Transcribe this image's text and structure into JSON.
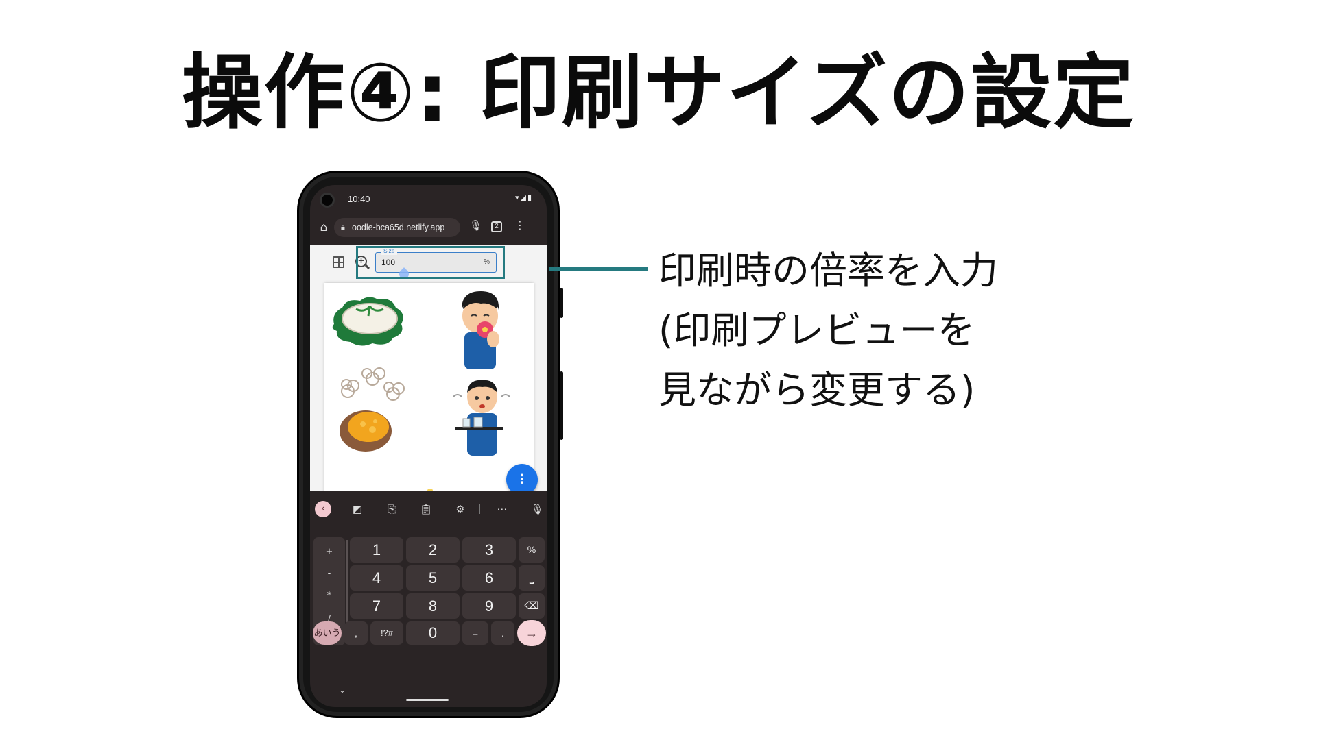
{
  "slide": {
    "title": "操作④: 印刷サイズの設定",
    "annotation_lines": [
      "印刷時の倍率を入力",
      "(印刷プレビューを",
      "見ながら変更する)"
    ],
    "accent_color": "#257a80"
  },
  "phone": {
    "status": {
      "time": "10:40",
      "icons": "wifi-icon, signal-icon, battery-icon"
    },
    "browser": {
      "url": "oodle-bca65d.netlify.app",
      "tab_count": "2"
    },
    "toolbar": {
      "size_label": "Size",
      "size_value": "100",
      "size_unit": "%"
    },
    "fab_icon": "more-vert-icon",
    "keyboard": {
      "number_keys": [
        "1",
        "2",
        "3",
        "4",
        "5",
        "6",
        "7",
        "8",
        "9",
        "0"
      ],
      "symbol_column": [
        "+",
        "-",
        "*",
        "/"
      ],
      "percent_key": "%",
      "kana_key": "あいう",
      "comma_key": ",",
      "symbols_key": "!?#",
      "equals_key": "=",
      "period_key": "."
    }
  }
}
